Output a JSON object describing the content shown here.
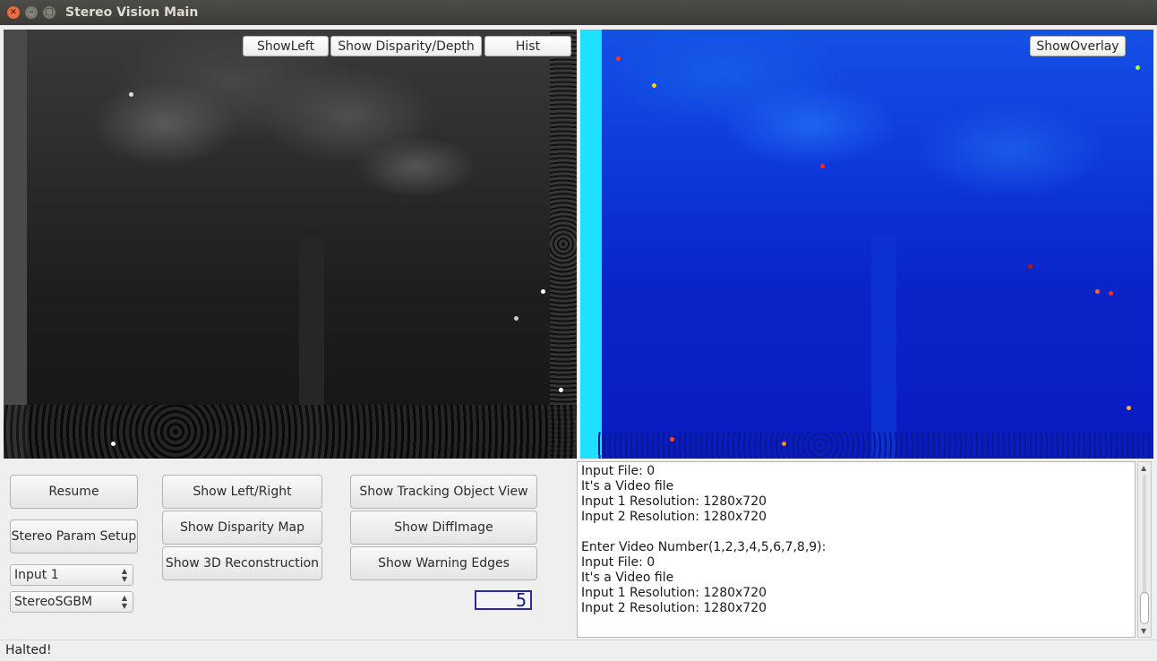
{
  "window": {
    "title": "Stereo Vision Main"
  },
  "image_left": {
    "buttons": {
      "show_left": "ShowLeft",
      "show_disparity": "Show Disparity/Depth",
      "hist": "Hist"
    }
  },
  "image_right": {
    "buttons": {
      "show_overlay": "ShowOverlay"
    }
  },
  "controls": {
    "resume": "Resume",
    "stereo_param_setup": "Stereo Param Setup",
    "input_select": "Input 1",
    "algorithm_select": "StereoSGBM",
    "show_left_right": "Show Left/Right",
    "show_disparity_map": "Show Disparity Map",
    "show_3d_reconstruction": "Show 3D Reconstruction",
    "show_tracking_object_view": "Show Tracking Object View",
    "show_diff_image": "Show DiffImage",
    "show_warning_edges": "Show Warning Edges",
    "lcd_value": "5"
  },
  "log": {
    "lines": [
      "Input File: 0",
      "It's a Video file",
      "Input 1 Resolution: 1280x720",
      "Input 2 Resolution: 1280x720",
      "",
      "Enter Video Number(1,2,3,4,5,6,7,8,9):",
      "Input File: 0",
      "It's a Video file",
      "Input 1 Resolution: 1280x720",
      "Input 2 Resolution: 1280x720"
    ]
  },
  "status": {
    "text": "Halted!"
  }
}
